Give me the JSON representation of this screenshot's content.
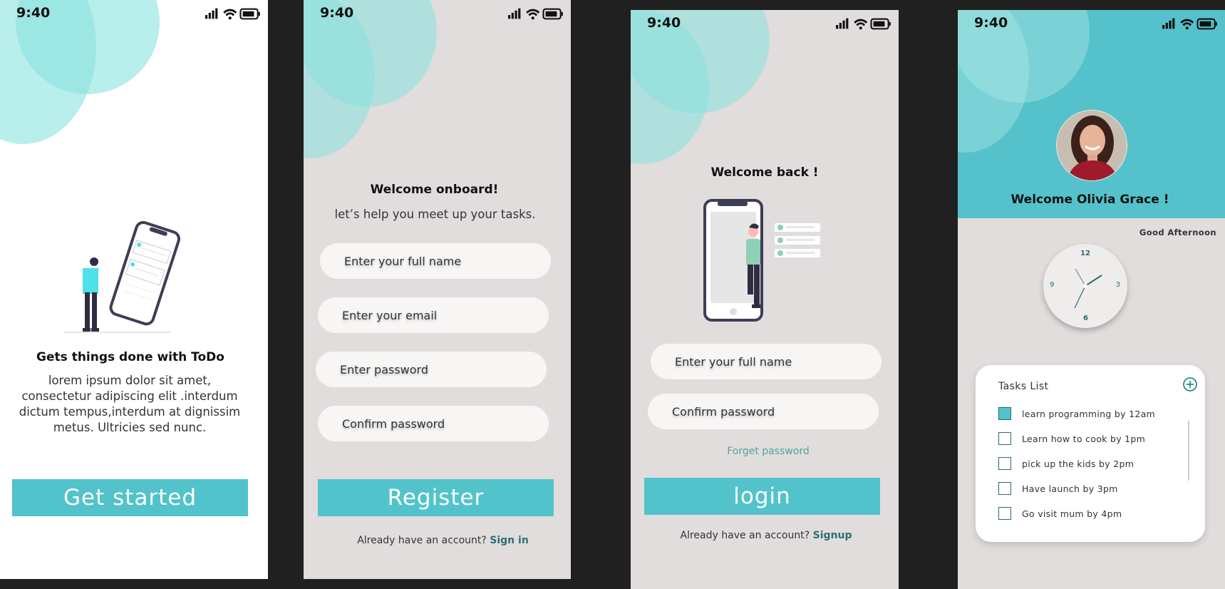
{
  "status_bar": {
    "time": "9:40"
  },
  "screen1": {
    "title": "Gets  things  done  with  ToDo",
    "body_line1": "lorem ipsum dolor sit amet,",
    "body_line2": "consectetur adipiscing elit .interdum",
    "body_line3": "dictum tempus,interdum at dignissim",
    "body_line4": "metus. Ultricies  sed nunc.",
    "button": "Get started"
  },
  "screen2": {
    "title": "Welcome  onboard!",
    "subtitle": "let’s help you meet up your tasks.",
    "fields": {
      "full_name": "Enter your full name",
      "email": "Enter your email",
      "password": "Enter password",
      "confirm": "Confirm  password"
    },
    "button": "Register",
    "footer_text": "Already have an account?",
    "footer_link": "Sign in"
  },
  "screen3": {
    "title": "Welcome  back !",
    "fields": {
      "full_name": "Enter your full name",
      "confirm": "Confirm  password"
    },
    "forget": "Forget password",
    "button": "login",
    "footer_text": "Already have an account?",
    "footer_link": "Signup"
  },
  "screen4": {
    "welcome": "Welcome  Olivia Grace !",
    "greeting": "Good Afternoon",
    "clock_numbers": {
      "n12": "12",
      "n3": "3",
      "n6": "6",
      "n9": "9"
    },
    "tasks_title": "Tasks List",
    "tasks": [
      {
        "label": "learn programming by 12am",
        "checked": true
      },
      {
        "label": "Learn how to cook  by 1pm",
        "checked": false
      },
      {
        "label": " pick up the kids by 2pm",
        "checked": false
      },
      {
        "label": "Have launch by 3pm",
        "checked": false
      },
      {
        "label": "Go visit mum by 4pm",
        "checked": false
      }
    ]
  },
  "colors": {
    "accent": "#52c3ca",
    "link_dark": "#2b6f73",
    "forget_link": "#55a39a",
    "screen_bg": "#e1dddd",
    "input_bg": "#f7f6f5"
  }
}
